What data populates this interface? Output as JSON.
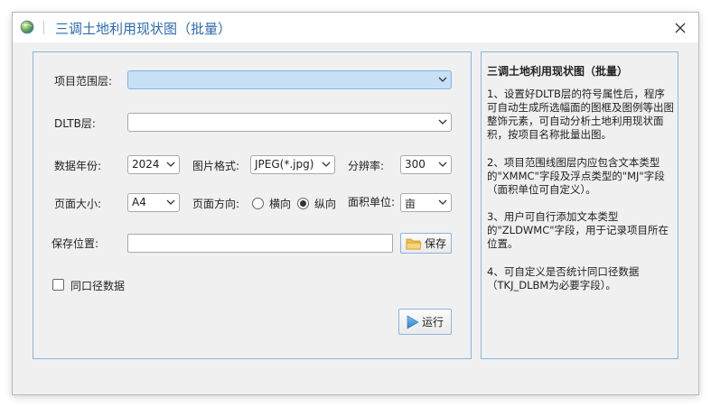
{
  "window": {
    "title": "三调土地利用现状图（批量）",
    "accent_color": "#2b6bb0",
    "border_color": "#8ab5de"
  },
  "form": {
    "project_layer_label": "项目范围层:",
    "project_layer_value": "",
    "dltb_label": "DLTB层:",
    "dltb_value": "",
    "year_label": "数据年份:",
    "year_value": "2024",
    "format_label": "图片格式:",
    "format_value": "JPEG(*.jpg)",
    "resolution_label": "分辨率:",
    "resolution_value": "300",
    "page_size_label": "页面大小:",
    "page_size_value": "A4",
    "orientation_label": "页面方向:",
    "orientation_landscape": "横向",
    "orientation_portrait": "纵向",
    "orientation_selected": "纵向",
    "area_unit_label": "面积单位:",
    "area_unit_value": "亩",
    "save_location_label": "保存位置:",
    "save_location_value": "",
    "save_button": "保存",
    "same_caliber_label": "同口径数据",
    "same_caliber_checked": false,
    "run_button": "运行"
  },
  "help": {
    "title": "三调土地利用现状图（批量）",
    "paragraphs": [
      "1、设置好DLTB层的符号属性后，程序可自动生成所选幅面的图框及图例等出图整饰元素，可自动分析土地利用现状面积，按项目名称批量出图。",
      "2、项目范围线图层内应包含文本类型的\"XMMC\"字段及浮点类型的\"MJ\"字段（面积单位可自定义）。",
      "3、用户可自行添加文本类型的\"ZLDWMC\"字段，用于记录项目所在位置。",
      "4、可自定义是否统计同口径数据（TKJ_DLBM为必要字段）。"
    ]
  },
  "icons": {
    "app": "globe-icon",
    "close": "close-icon",
    "dropdown": "chevron-down-icon",
    "folder": "folder-icon",
    "run": "play-icon"
  }
}
